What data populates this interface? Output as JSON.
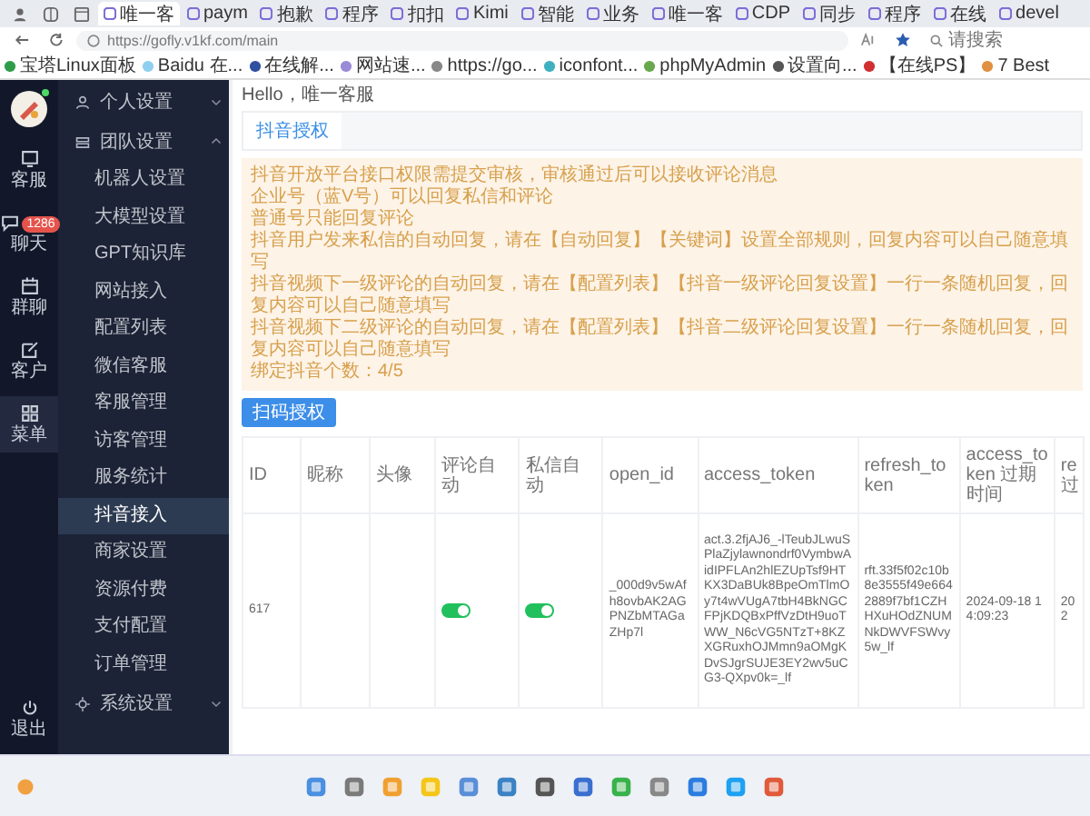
{
  "browser": {
    "tabs": [
      {
        "title": "唯一客",
        "selected": true
      },
      {
        "title": "paym",
        "selected": false
      },
      {
        "title": "抱歉",
        "selected": false
      },
      {
        "title": "程序",
        "selected": false
      },
      {
        "title": "扣扣",
        "selected": false
      },
      {
        "title": "Kimi",
        "selected": false
      },
      {
        "title": "智能",
        "selected": false
      },
      {
        "title": "业务",
        "selected": false
      },
      {
        "title": "唯一客",
        "selected": false
      },
      {
        "title": "CDP",
        "selected": false
      },
      {
        "title": "同步",
        "selected": false
      },
      {
        "title": "程序",
        "selected": false
      },
      {
        "title": "在线",
        "selected": false
      },
      {
        "title": "devel",
        "selected": false
      }
    ],
    "address": "https://gofly.v1kf.com/main",
    "search": {
      "placeholder": "请搜索"
    },
    "bookmarks": [
      "宝塔Linux面板",
      "Baidu 在...",
      "在线解...",
      "网站速...",
      "https://go...",
      "iconfont...",
      "phpMyAdmin",
      "设置向...",
      "【在线PS】",
      "7 Best"
    ]
  },
  "rail": {
    "items": [
      {
        "label": "客服",
        "selected": false
      },
      {
        "label": "聊天",
        "selected": false,
        "badge": "1286"
      },
      {
        "label": "群聊",
        "selected": false
      },
      {
        "label": "客户",
        "selected": false
      },
      {
        "label": "菜单",
        "selected": true
      }
    ],
    "footer": "退出"
  },
  "menu": {
    "items": [
      {
        "label": "个人设置",
        "expanded": false
      },
      {
        "label": "团队设置",
        "expanded": true,
        "children": [
          {
            "label": "机器人设置",
            "selected": false
          },
          {
            "label": "大模型设置",
            "selected": false
          },
          {
            "label": "GPT知识库",
            "selected": false
          },
          {
            "label": "网站接入",
            "selected": false
          },
          {
            "label": "配置列表",
            "selected": false
          },
          {
            "label": "微信客服",
            "selected": false
          },
          {
            "label": "客服管理",
            "selected": false
          },
          {
            "label": "访客管理",
            "selected": false
          },
          {
            "label": "服务统计",
            "selected": false
          },
          {
            "label": "抖音接入",
            "selected": true
          },
          {
            "label": "商家设置",
            "selected": false
          },
          {
            "label": "资源付费",
            "selected": false
          },
          {
            "label": "支付配置",
            "selected": false
          },
          {
            "label": "订单管理",
            "selected": false
          }
        ]
      },
      {
        "label": "系统设置",
        "expanded": false
      }
    ]
  },
  "greeting": "Hello，唯一客服",
  "tabs": [
    {
      "label": "抖音授权",
      "selected": true
    }
  ],
  "notice": {
    "lines": [
      "抖音开放平台接口权限需提交审核，审核通过后可以接收评论消息",
      "企业号（蓝V号）可以回复私信和评论",
      "普通号只能回复评论",
      "抖音用户发来私信的自动回复，请在【自动回复】【关键词】设置全部规则，回复内容可以自己随意填写",
      "抖音视频下一级评论的自动回复，请在【配置列表】【抖音一级评论回复设置】一行一条随机回复，回复内容可以自己随意填写",
      "抖音视频下二级评论的自动回复，请在【配置列表】【抖音二级评论回复设置】一行一条随机回复，回复内容可以自己随意填写",
      "绑定抖音个数：4/5"
    ]
  },
  "action_button": "扫码授权",
  "table": {
    "columns": [
      "ID",
      "昵称",
      "头像",
      "评论自动",
      "私信自动",
      "open_id",
      "access_token",
      "refresh_token",
      "access_token 过期时间",
      "re 过"
    ],
    "rows": [
      {
        "cells": [
          {
            "kind": "text",
            "text": "617"
          },
          {
            "kind": "empty"
          },
          {
            "kind": "empty"
          },
          {
            "kind": "toggle",
            "on": true
          },
          {
            "kind": "toggle",
            "on": true
          },
          {
            "kind": "text",
            "text": "_000d9v5wAfh8ovbAK2AGPNZbMTAGaZHp7l"
          },
          {
            "kind": "text",
            "text": "act.3.2fjAJ6_-lTeubJLwuSPlaZjylawnondrf0VymbwAidIPFLAn2hlEZUpTsf9HTKX3DaBUk8BpeOmTlmOy7t4wVUgA7tbH4BkNGCFPjKDQBxPffVzDtH9uoTWW_N6cVG5NTzT+8KZXGRuxhOJMmn9aOMgKDvSJgrSUJE3EY2wv5uCG3-QXpv0k=_lf"
          },
          {
            "kind": "text",
            "text": "rft.33f5f02c10b8e3555f49e6642889f7bf1CZHHXuHOdZNUMNkDWVFSWvy5w_lf"
          },
          {
            "kind": "text",
            "text": "2024-09-18 14:09:23"
          },
          {
            "kind": "text",
            "text": "202"
          }
        ]
      }
    ]
  }
}
